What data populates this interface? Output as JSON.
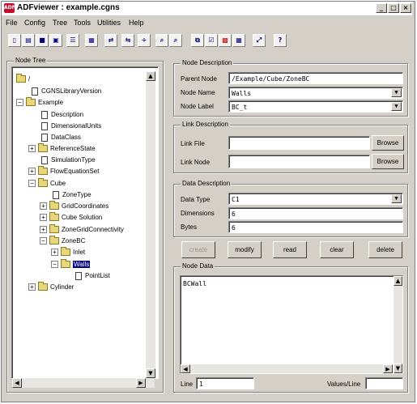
{
  "window": {
    "title": "ADFviewer : example.cgns",
    "icon_label": "ADF",
    "minimize_icon": "_",
    "maximize_icon": "□",
    "close_icon": "×"
  },
  "menu": [
    "File",
    "Config",
    "Tree",
    "Tools",
    "Utilities",
    "Help"
  ],
  "toolbar": {
    "buttons": [
      {
        "name": "new-icon",
        "glyph": "▯"
      },
      {
        "name": "open-icon",
        "glyph": "▤"
      },
      {
        "name": "save-icon",
        "glyph": "■"
      },
      {
        "name": "save-as-icon",
        "glyph": "▣"
      },
      {
        "name": "properties-icon",
        "glyph": "☰"
      },
      {
        "name": "view-icon",
        "glyph": "▦"
      },
      {
        "name": "link-icon",
        "glyph": "⇄"
      },
      {
        "name": "unlink-icon",
        "glyph": "⇆"
      },
      {
        "name": "ratio-icon",
        "glyph": "÷"
      },
      {
        "name": "find-icon",
        "glyph": "⌕"
      },
      {
        "name": "find-next-icon",
        "glyph": "⌕"
      },
      {
        "name": "copy-icon",
        "glyph": "⧉"
      },
      {
        "name": "check-icon",
        "glyph": "☑"
      },
      {
        "name": "plot-icon",
        "glyph": "▩"
      },
      {
        "name": "grid-icon",
        "glyph": "▦"
      },
      {
        "name": "expand-icon",
        "glyph": "⤢"
      },
      {
        "name": "help-icon",
        "glyph": "?"
      }
    ]
  },
  "tree": {
    "title": "Node Tree",
    "nodes": [
      {
        "label": "/",
        "type": "folder",
        "expander": "",
        "selected": false
      },
      {
        "label": "CGNSLibraryVersion",
        "type": "doc",
        "expander": "",
        "selected": false
      },
      {
        "label": "Example",
        "type": "folder",
        "expander": "−",
        "selected": false
      },
      {
        "label": "Description",
        "type": "doc",
        "expander": "",
        "selected": false
      },
      {
        "label": "DimensionalUnits",
        "type": "doc",
        "expander": "",
        "selected": false
      },
      {
        "label": "DataClass",
        "type": "doc",
        "expander": "",
        "selected": false
      },
      {
        "label": "ReferenceState",
        "type": "folder",
        "expander": "+",
        "selected": false
      },
      {
        "label": "SimulationType",
        "type": "doc",
        "expander": "",
        "selected": false
      },
      {
        "label": "FlowEquationSet",
        "type": "folder",
        "expander": "+",
        "selected": false
      },
      {
        "label": "Cube",
        "type": "folder",
        "expander": "−",
        "selected": false
      },
      {
        "label": "ZoneType",
        "type": "doc",
        "expander": "",
        "selected": false
      },
      {
        "label": "GridCoordinates",
        "type": "folder",
        "expander": "+",
        "selected": false
      },
      {
        "label": "Cube Solution",
        "type": "folder",
        "expander": "+",
        "selected": false
      },
      {
        "label": "ZoneGridConnectivity",
        "type": "folder",
        "expander": "+",
        "selected": false
      },
      {
        "label": "ZoneBC",
        "type": "folder",
        "expander": "−",
        "selected": false
      },
      {
        "label": "Inlet",
        "type": "folder",
        "expander": "+",
        "selected": false
      },
      {
        "label": "Walls",
        "type": "folder",
        "expander": "−",
        "selected": true
      },
      {
        "label": "PointList",
        "type": "doc",
        "expander": "",
        "selected": false
      },
      {
        "label": "Cylinder",
        "type": "folder",
        "expander": "+",
        "selected": false
      }
    ]
  },
  "node_description": {
    "title": "Node Description",
    "parent_label": "Parent Node",
    "parent_value": "/Example/Cube/ZoneBC",
    "name_label": "Node Name",
    "name_value": "Walls",
    "type_label": "Node Label",
    "type_value": "BC_t"
  },
  "link_description": {
    "title": "Link Description",
    "file_label": "Link File",
    "file_value": "",
    "node_label": "Link Node",
    "node_value": "",
    "browse_label": "Browse"
  },
  "data_description": {
    "title": "Data Description",
    "type_label": "Data Type",
    "type_value": "C1",
    "dims_label": "Dimensions",
    "dims_value": "6",
    "bytes_label": "Bytes",
    "bytes_value": "6"
  },
  "actions": [
    "create",
    "modify",
    "read",
    "clear",
    "delete"
  ],
  "node_data": {
    "title": "Node Data",
    "content": "BCWall",
    "line_label": "Line",
    "line_value": "1",
    "values_label": "Values/Line",
    "values_value": ""
  }
}
